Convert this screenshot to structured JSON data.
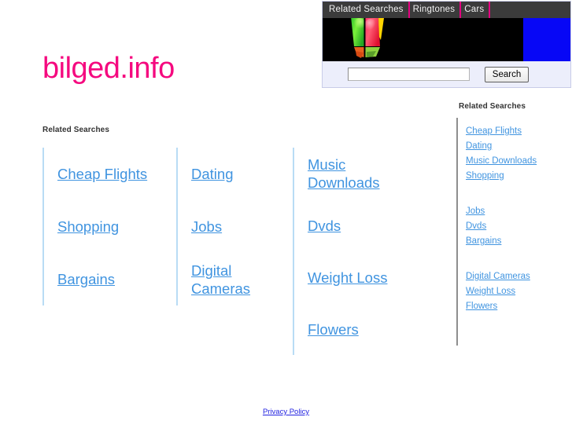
{
  "site": {
    "title": "bilged.info",
    "title_color": "#f5097f"
  },
  "ad": {
    "tabs": [
      {
        "label": "Related Searches"
      },
      {
        "label": "Ringtones"
      },
      {
        "label": "Cars"
      }
    ],
    "media": {
      "icon": "lantern-graphic",
      "background_color": "#000000",
      "panel_color": "#0707f6"
    },
    "search": {
      "value": "",
      "placeholder": "",
      "button_label": "Search"
    },
    "tab_separator_color": "#e4007f",
    "tabbar_color": "#3b3b3b"
  },
  "main": {
    "heading": "Related Searches",
    "link_color": "#4094e0",
    "cell_border_color": "#b9dcf5",
    "columns": [
      {
        "cells": [
          "Cheap Flights",
          "Shopping",
          "Bargains"
        ]
      },
      {
        "cells": [
          "Dating",
          "Jobs",
          "Digital Cameras"
        ]
      },
      {
        "cells": [
          "Music Downloads",
          "Dvds",
          "Weight Loss",
          "Flowers"
        ]
      }
    ]
  },
  "sidebar": {
    "heading": "Related Searches",
    "divider_color": "#8e8e8e",
    "groups": [
      {
        "links": [
          "Cheap Flights",
          "Dating",
          "Music Downloads",
          "Shopping"
        ]
      },
      {
        "links": [
          "Jobs",
          "Dvds",
          "Bargains"
        ]
      },
      {
        "links": [
          "Digital Cameras",
          "Weight Loss",
          "Flowers"
        ]
      }
    ]
  },
  "footer": {
    "privacy_label": "Privacy Policy",
    "link_color": "#2121e0"
  }
}
